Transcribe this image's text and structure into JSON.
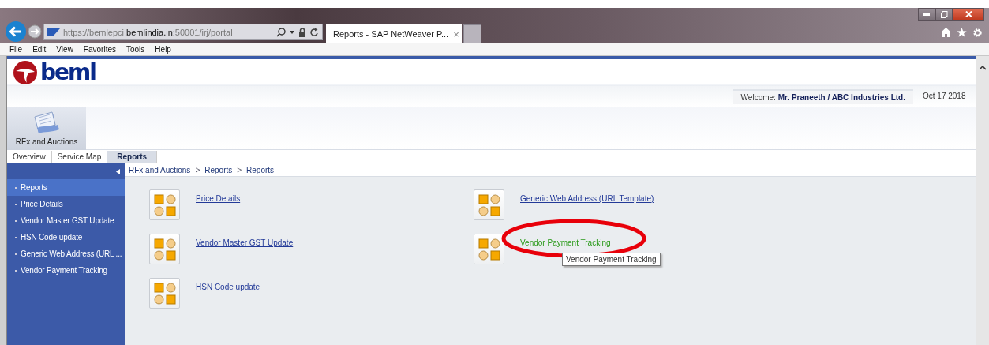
{
  "browser": {
    "address": "https://bemlepci.**bemlindia.in**:50001/irj/portal",
    "tab": {
      "title": "Reports - SAP NetWeaver P...",
      "close": "×"
    },
    "menu": [
      "File",
      "Edit",
      "View",
      "Favorites",
      "Tools",
      "Help"
    ]
  },
  "portal": {
    "logo": "beml",
    "welcome_label": "Welcome:",
    "welcome_user": "Mr. Praneeth / ABC Industries Ltd.",
    "date": "Oct 17 2018",
    "tool": {
      "label": "RFx and Auctions"
    },
    "tabs": [
      {
        "label": "Overview",
        "selected": false
      },
      {
        "label": "Service Map",
        "selected": false
      },
      {
        "label": "Reports",
        "selected": true
      }
    ],
    "sidebar": {
      "items": [
        {
          "label": "Reports",
          "selected": true
        },
        {
          "label": "Price Details",
          "selected": false
        },
        {
          "label": "Vendor Master GST Update",
          "selected": false
        },
        {
          "label": "HSN Code update",
          "selected": false
        },
        {
          "label": "Generic Web Address (URL ...",
          "selected": false
        },
        {
          "label": "Vendor Payment Tracking",
          "selected": false
        }
      ]
    },
    "breadcrumb": [
      "RFx and Auctions",
      ">",
      "Reports",
      ">",
      "Reports"
    ],
    "columns": [
      [
        {
          "label": "Price Details",
          "hovered": false,
          "circled": false
        },
        {
          "label": "Vendor Master GST Update",
          "hovered": false,
          "circled": false
        },
        {
          "label": "HSN Code update",
          "hovered": false,
          "circled": false
        }
      ],
      [
        {
          "label": "Generic Web Address (URL Template)",
          "hovered": false,
          "circled": false
        },
        {
          "label": "Vendor Payment Tracking",
          "hovered": true,
          "circled": true,
          "tooltip": "Vendor Payment Tracking"
        }
      ]
    ]
  }
}
